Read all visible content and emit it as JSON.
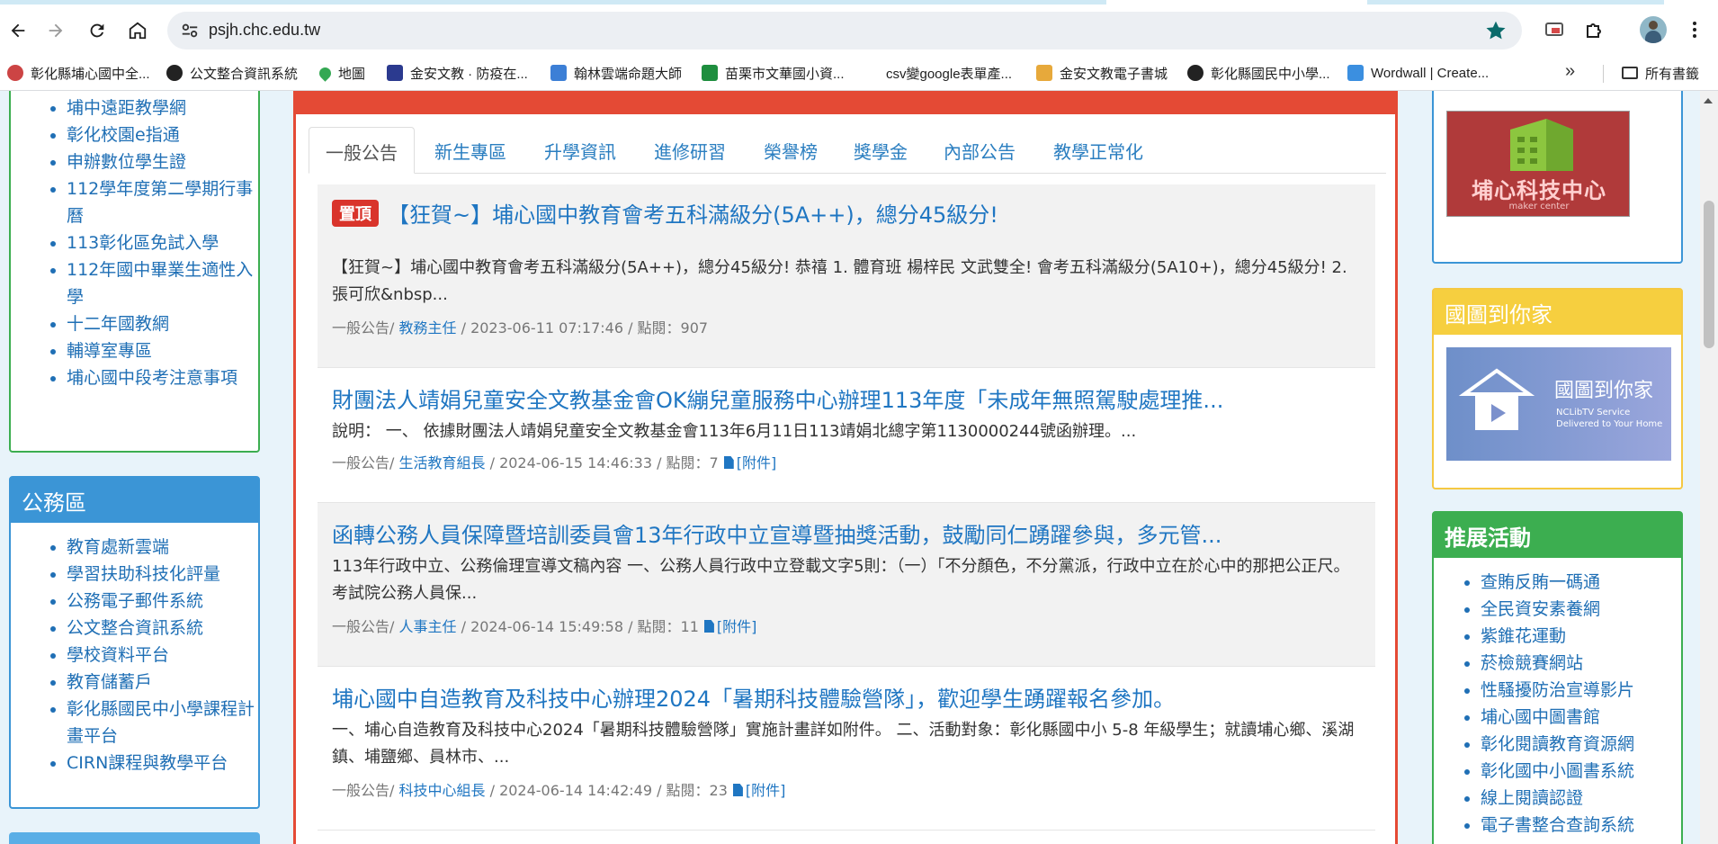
{
  "browser": {
    "url": "psjh.chc.edu.tw",
    "bookmarks": [
      {
        "label": "彰化縣埔心國中全..."
      },
      {
        "label": "公文整合資訊系統"
      },
      {
        "label": "地圖"
      },
      {
        "label": "金安文教 · 防疫在..."
      },
      {
        "label": "翰林雲端命題大師"
      },
      {
        "label": "苗栗市文華國小資..."
      },
      {
        "label": "csv變google表單產..."
      },
      {
        "label": "金安文教電子書城"
      },
      {
        "label": "彰化縣國民中小學..."
      },
      {
        "label": "Wordwall | Create..."
      }
    ],
    "more_bookmarks": "»",
    "all_bookmarks": "所有書籤"
  },
  "left": {
    "panel1": {
      "items": [
        "埔中遠距教學網",
        "彰化校園e指通",
        "申辦數位學生證",
        "112學年度第二學期行事曆",
        "113彰化區免試入學",
        "112年國中畢業生適性入學",
        "十二年國教網",
        "輔導室專區",
        "埔心國中段考注意事項"
      ]
    },
    "panel2": {
      "title": "公務區",
      "items": [
        "教育處新雲端",
        "學習扶助科技化評量",
        "公務電子郵件系統",
        "公文整合資訊系統",
        "學校資料平台",
        "教育儲蓄戶",
        "彰化縣國民中小學課程計畫平台",
        "CIRN課程與教學平台"
      ]
    }
  },
  "main": {
    "tabs": [
      "一般公告",
      "新生專區",
      "升學資訊",
      "進修研習",
      "榮譽榜",
      "獎學金",
      "內部公告",
      "教學正常化"
    ],
    "news": [
      {
        "badge": "置頂",
        "title": "【狂賀~】埔心國中教育會考五科滿級分(5A++)，總分45級分!",
        "body": "【狂賀~】埔心國中教育會考五科滿級分(5A++)，總分45級分! 恭禧 1. 體育班 楊梓民 文武雙全! 會考五科滿級分(5A10+)，總分45級分! 2.張可欣&nbsp...",
        "category": "一般公告/ ",
        "author": "教務主任",
        "meta": " / 2023-06-11 07:17:46 / 點閱：907"
      },
      {
        "title": "財團法人靖娟兒童安全文教基金會OK繃兒童服務中心辦理113年度「未成年無照駕駛處理推...",
        "body": "說明： 一、 依據財團法人靖娟兒童安全文教基金會113年6月11日113靖娟北總字第1130000244號函辦理。...",
        "category": "一般公告/ ",
        "author": "生活教育組長",
        "meta": " / 2024-06-15 14:46:33 / 點閱：7",
        "attachment": "[附件]"
      },
      {
        "title": "函轉公務人員保障暨培訓委員會13年行政中立宣導暨抽獎活動，鼓勵同仁踴躍參與，多元管...",
        "body": "113年行政中立、公務倫理宣導文稿內容 一、公務人員行政中立登載文字5則：（一）「不分顏色，不分黨派，行政中立在於心中的那把公正尺。考試院公務人員保...",
        "category": "一般公告/ ",
        "author": "人事主任",
        "meta": " / 2024-06-14 15:49:58 / 點閱：11",
        "attachment": "[附件]"
      },
      {
        "title": "埔心國中自造教育及科技中心辦理2024「暑期科技體驗營隊」，歡迎學生踴躍報名參加。",
        "body": "一、埔心自造教育及科技中心2024「暑期科技體驗營隊」實施計畫詳如附件。 二、活動對象：彰化縣國中小 5-8 年級學生；就讀埔心鄉、溪湖鎮、埔鹽鄉、員林市、...",
        "category": "一般公告/ ",
        "author": "科技中心組長",
        "meta": " / 2024-06-14 14:42:49 / 點閱：23",
        "attachment": "[附件]"
      }
    ]
  },
  "right": {
    "logo": {
      "text": "埔心科技中心",
      "sub": "maker center"
    },
    "nclib": {
      "title": "國圖到你家",
      "banner_title": "國圖到你家",
      "banner_sub": "NCLibTV Service Delivered to Your Home"
    },
    "activities": {
      "title": "推展活動",
      "items": [
        "查賄反賄一碼通",
        "全民資安素養網",
        "紫錐花運動",
        "菸檢競賽網站",
        "性騷擾防治宣導影片",
        "埔心國中圖書館",
        "彰化閱讀教育資源網",
        "彰化國中小圖書系統",
        "線上閱讀認證",
        "電子書整合查詢系統"
      ]
    }
  }
}
